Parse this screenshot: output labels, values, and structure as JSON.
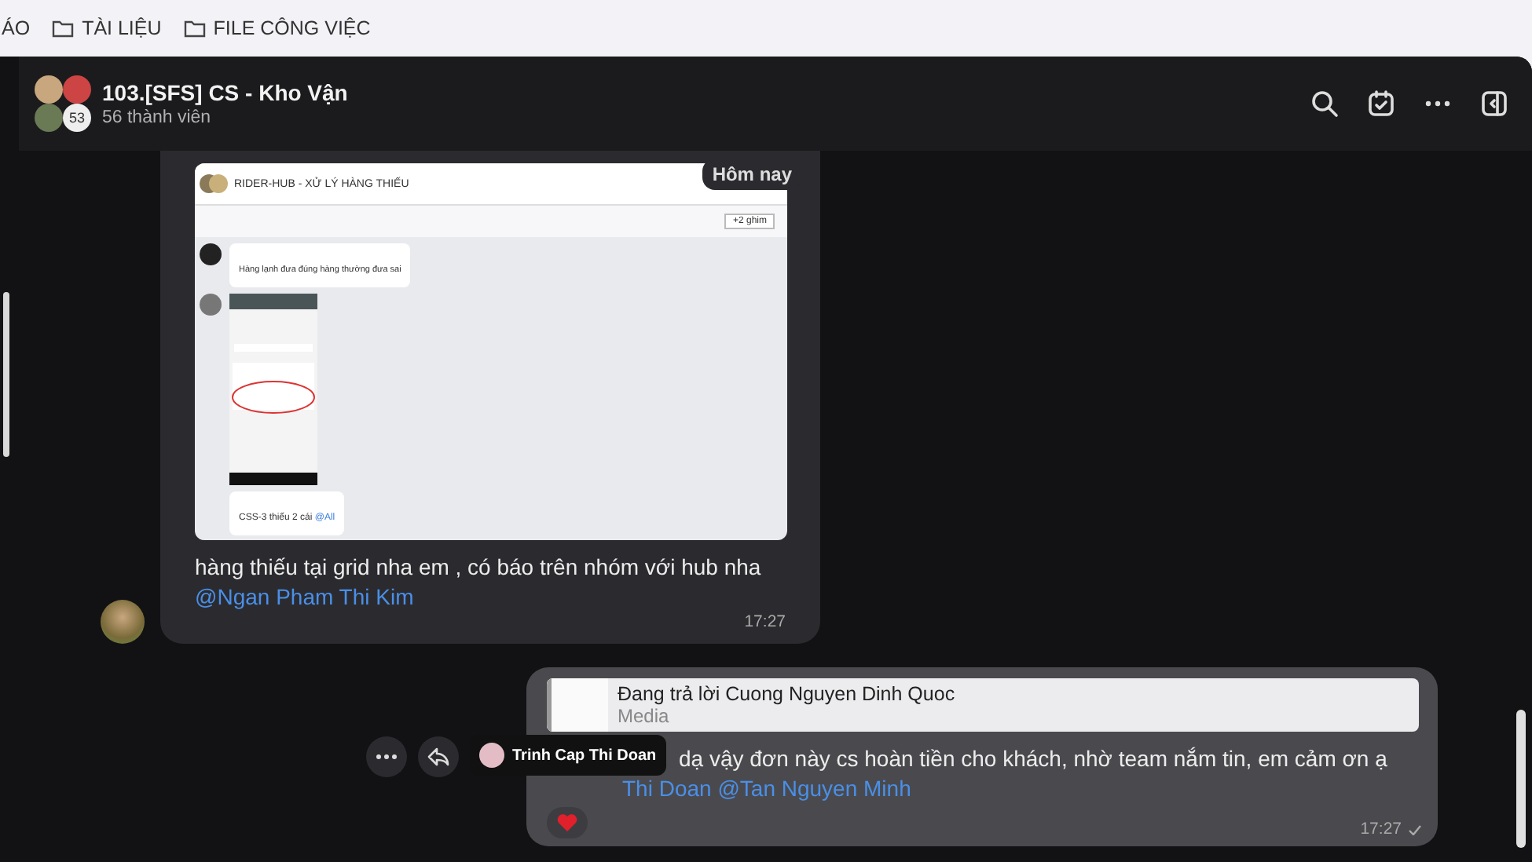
{
  "bookmarks": [
    {
      "kind": "plain",
      "label": "ÁO"
    },
    {
      "kind": "folder",
      "label": "TÀI LIỆU"
    },
    {
      "kind": "folder",
      "label": "FILE CÔNG VIỆC"
    }
  ],
  "chat": {
    "title": "103.[SFS] CS - Kho Vận",
    "members": "56 thành viên",
    "avatar_count": "53"
  },
  "date_badge": "Hôm nay",
  "messages": [
    {
      "kind": "incoming",
      "shared_screenshot": {
        "group_title": "RIDER-HUB - XỬ LÝ HÀNG THIẾU",
        "pins": "+2 ghim",
        "message": "Hàng lạnh đưa đúng hàng thường đưa sai",
        "caption": "CSS-3 thiếu 2 cái",
        "caption_mention": "@All"
      },
      "text": "hàng thiếu tại grid nha em , có báo trên nhóm với hub nha",
      "mention": "@Ngan Pham Thi Kim",
      "time": "17:27"
    },
    {
      "kind": "outgoing",
      "reply": {
        "title": "Đang trả lời Cuong Nguyen Dinh Quoc",
        "subtitle": "Media"
      },
      "text": "dạ vậy đơn này cs hoàn tiền cho khách, nhờ team nắm tin, em cảm ơn ạ",
      "mention": "Thi Doan @Tan Nguyen Minh",
      "time": "17:27",
      "delivered": true,
      "heart_reacted": true
    }
  ],
  "tooltip": {
    "name": "Trinh Cap Thi Doan"
  }
}
